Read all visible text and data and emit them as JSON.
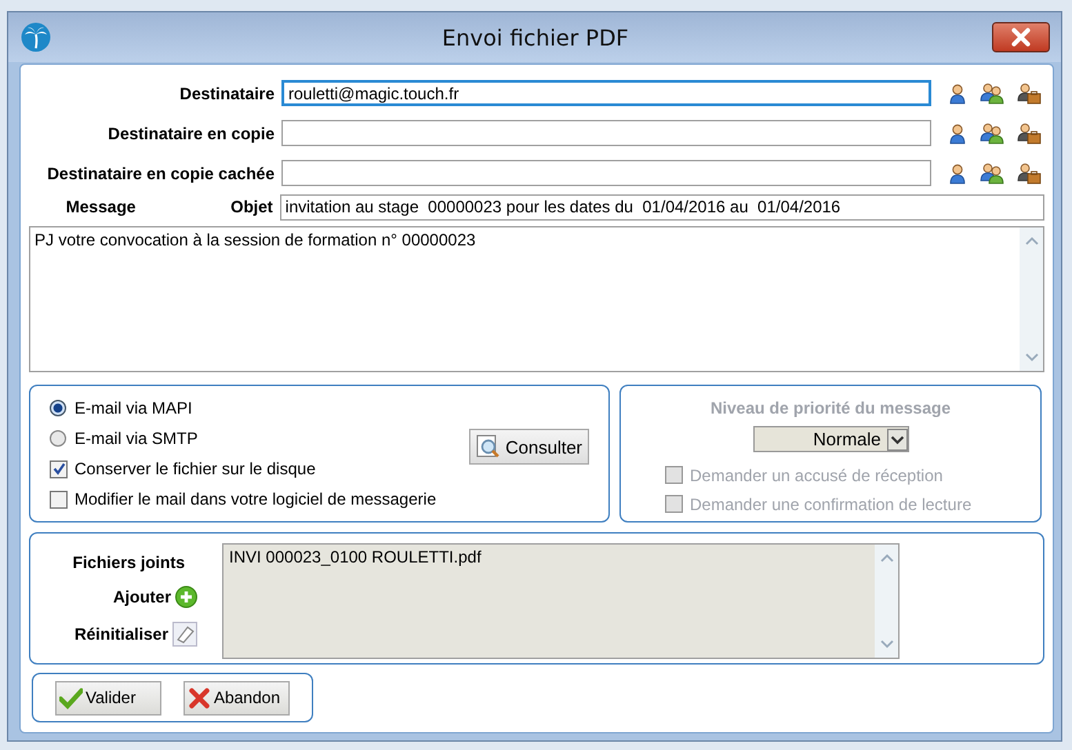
{
  "window": {
    "title": "Envoi fichier PDF"
  },
  "recipients": [
    {
      "label": "Destinataire",
      "value": "rouletti@magic.touch.fr",
      "focused": true
    },
    {
      "label": "Destinataire en copie",
      "focused": false
    },
    {
      "label": "Destinataire en copie cachée",
      "focused": false
    }
  ],
  "message": {
    "label": "Message",
    "subject_label": "Objet",
    "subject": "invitation au stage  00000023 pour les dates du  01/04/2016 au  01/04/2016",
    "body": "PJ votre convocation à la session de formation n° 00000023"
  },
  "send_options": {
    "methods": [
      {
        "label": "E-mail via MAPI",
        "selected": true
      },
      {
        "label": "E-mail via SMTP",
        "selected": false
      }
    ],
    "consult_button": "Consulter",
    "checkboxes": [
      {
        "label": "Conserver le fichier sur le disque",
        "checked": true
      },
      {
        "label": "Modifier le mail dans votre logiciel de messagerie",
        "checked": false
      }
    ]
  },
  "priority": {
    "title": "Niveau de priorité du message",
    "value": "Normale",
    "disabled": true,
    "checkboxes": [
      {
        "label": "Demander un accusé de réception",
        "checked": false
      },
      {
        "label": "Demander une confirmation de lecture",
        "checked": false
      }
    ]
  },
  "attachments": {
    "label": "Fichiers joints",
    "add_label": "Ajouter",
    "reset_label": "Réinitialiser",
    "files": [
      "INVI 000023_0100 ROULETTI.pdf"
    ]
  },
  "buttons": [
    {
      "label": "Valider",
      "kind": "ok"
    },
    {
      "label": "Abandon",
      "kind": "cancel"
    }
  ]
}
